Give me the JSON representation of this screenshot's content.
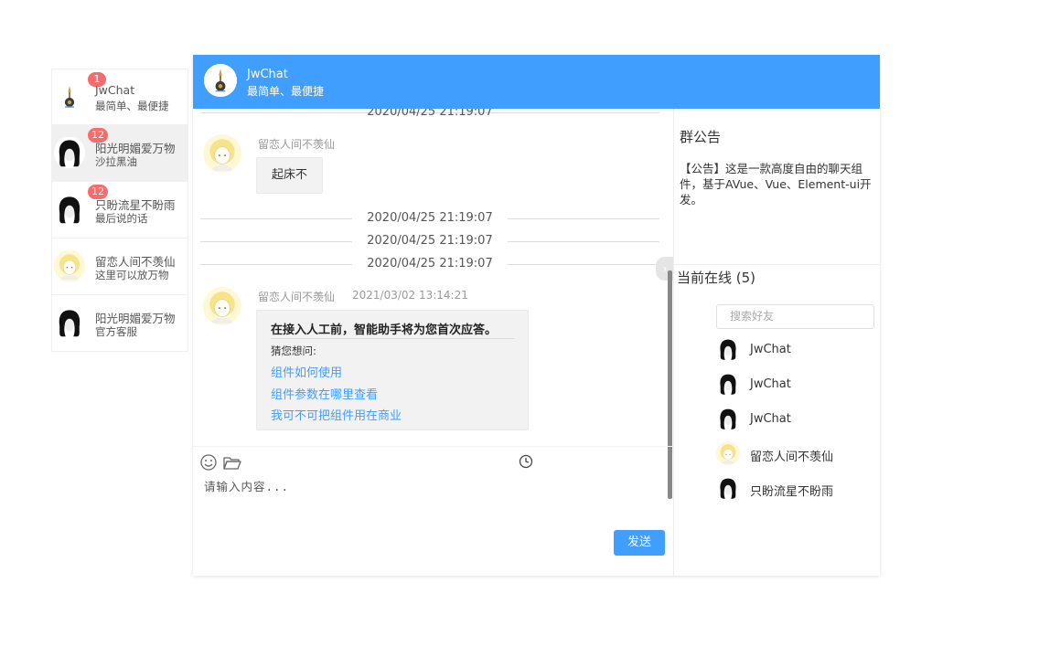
{
  "contacts": [
    {
      "name": "JwChat",
      "desc": "最简单、最便捷",
      "badge": "1",
      "avatar": "bell-icon"
    },
    {
      "name": "阳光明媚爱万物",
      "desc": "沙拉黑油",
      "badge": "12",
      "avatar": "girl-avatar"
    },
    {
      "name": "只盼流星不盼雨",
      "desc": "最后说的话",
      "badge": "12",
      "avatar": "girl-avatar"
    },
    {
      "name": "留恋人间不羡仙",
      "desc": "这里可以放万物",
      "badge": "",
      "avatar": "anime-avatar"
    },
    {
      "name": "阳光明媚爱万物",
      "desc": "官方客服",
      "badge": "",
      "avatar": "girl-avatar"
    }
  ],
  "header": {
    "title": "JwChat",
    "subtitle": "最简单、最便捷"
  },
  "messages": {
    "top_time": "2020/04/25 21:19:07",
    "msg1": {
      "name": "留恋人间不羡仙",
      "text": "起床不"
    },
    "times": [
      "2020/04/25 21:19:07",
      "2020/04/25 21:19:07",
      "2020/04/25 21:19:07"
    ],
    "msg2": {
      "name": "留恋人间不羡仙",
      "time": "2021/03/02 13:14:21",
      "card_title": "在接入人工前，智能助手将为您首次应答。",
      "card_sub": "猜您想问:",
      "links": [
        "组件如何使用",
        "组件参数在哪里查看",
        "我可不可把组件用在商业"
      ]
    }
  },
  "input": {
    "placeholder": "请输入内容..."
  },
  "send_label": "发送",
  "notice": {
    "title": "群公告",
    "body": "【公告】这是一款高度自由的聊天组件，基于AVue、Vue、Element-ui开发。"
  },
  "online": {
    "title": "当前在线 (5)",
    "search_placeholder": "搜索好友",
    "users": [
      {
        "name": "JwChat",
        "avatar": "girl-avatar"
      },
      {
        "name": "JwChat",
        "avatar": "girl-avatar"
      },
      {
        "name": "JwChat",
        "avatar": "girl-avatar"
      },
      {
        "name": "留恋人间不羡仙",
        "avatar": "anime-avatar"
      },
      {
        "name": "只盼流星不盼雨",
        "avatar": "girl-avatar"
      }
    ]
  },
  "colors": {
    "primary": "#409eff",
    "badge": "#f56c6c"
  }
}
